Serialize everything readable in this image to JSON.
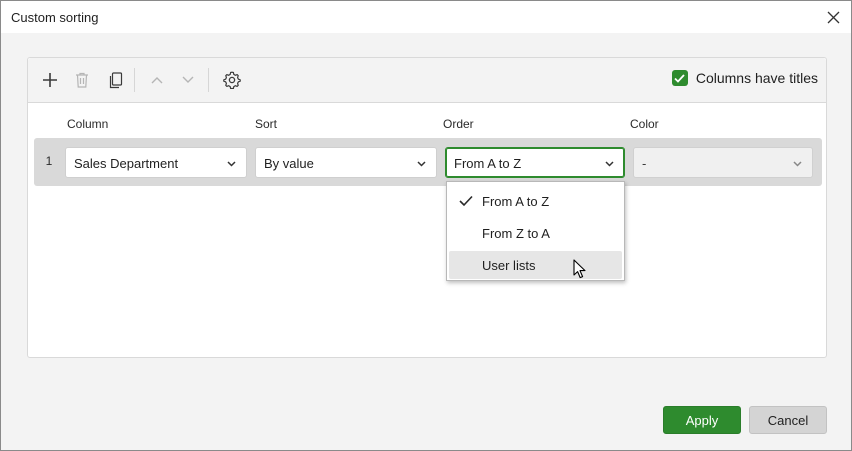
{
  "dialog": {
    "title": "Custom sorting",
    "close_icon": "close-icon"
  },
  "toolbar": {
    "icons": [
      "plus-icon",
      "trash-icon",
      "copy-icon",
      "arrow-up-icon",
      "arrow-down-icon",
      "gear-icon"
    ],
    "columns_have_titles": {
      "label": "Columns have titles",
      "checked": true
    }
  },
  "columns": {
    "column": "Column",
    "sort": "Sort",
    "order": "Order",
    "color": "Color"
  },
  "rows": [
    {
      "number": "1",
      "column_value": "Sales Department",
      "sort_value": "By value",
      "order_value": "From A to Z",
      "color_value": "-"
    }
  ],
  "order_dropdown": {
    "options": [
      {
        "label": "From A to Z",
        "selected": true
      },
      {
        "label": "From Z to A",
        "selected": false
      },
      {
        "label": "User lists",
        "selected": false,
        "hovered": true
      }
    ]
  },
  "footer": {
    "apply_label": "Apply",
    "cancel_label": "Cancel"
  },
  "colors": {
    "accent": "#2e8b2e",
    "panel_bg": "#f3f3f3",
    "row_bg": "#d9d9d9"
  }
}
